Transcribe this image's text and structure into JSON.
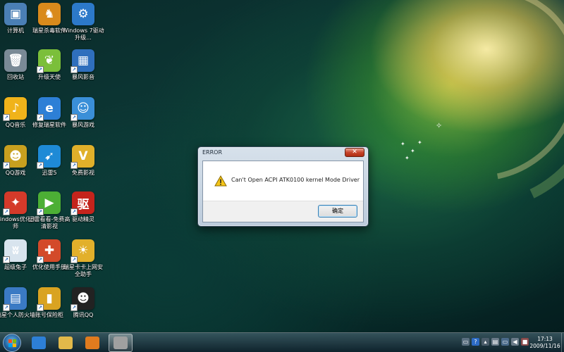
{
  "desktop": {
    "icons": [
      {
        "label": "计算机",
        "glyph": "▣",
        "color": "#4a7fb5"
      },
      {
        "label": "瑞星杀毒软件",
        "glyph": "♞",
        "color": "#d98a1c"
      },
      {
        "label": "Windows 7驱动升级...",
        "glyph": "⚙",
        "color": "#2c79c9"
      },
      {
        "label": "回收站",
        "glyph": "🗑",
        "color": "#7a8a96"
      },
      {
        "label": "升级天使",
        "glyph": "❦",
        "color": "#7bbf3a"
      },
      {
        "label": "暴风影音",
        "glyph": "▦",
        "color": "#2f6fbd"
      },
      {
        "label": "QQ音乐",
        "glyph": "♪",
        "color": "#f0b31a"
      },
      {
        "label": "修复瑞星软件",
        "glyph": "e",
        "color": "#2d7fd6"
      },
      {
        "label": "暴风游戏",
        "glyph": "☺",
        "color": "#3a8fd8"
      },
      {
        "label": "QQ游戏",
        "glyph": "☻",
        "color": "#c8a01f"
      },
      {
        "label": "迅雷5",
        "glyph": "➹",
        "color": "#1e8ad6"
      },
      {
        "label": "免费影视",
        "glyph": "V",
        "color": "#e0b02a"
      },
      {
        "label": "Windows优化大师",
        "glyph": "✦",
        "color": "#d43a2a"
      },
      {
        "label": "迅雷看看-免费高清影视",
        "glyph": "▶",
        "color": "#4caf35"
      },
      {
        "label": "驱动精灵",
        "glyph": "驱",
        "color": "#c4241c"
      },
      {
        "label": "超级兔子",
        "glyph": "ʬ",
        "color": "#d8e4ee"
      },
      {
        "label": "优化使用手册",
        "glyph": "✚",
        "color": "#d34a2a"
      },
      {
        "label": "瑞星卡卡上网安全助手",
        "glyph": "☀",
        "color": "#e2b02b"
      },
      {
        "label": "瑞星个人防火墙",
        "glyph": "▤",
        "color": "#3a7ac4"
      },
      {
        "label": "账号保险柜",
        "glyph": "▮",
        "color": "#d9a321"
      },
      {
        "label": "腾讯QQ",
        "glyph": "☻",
        "color": "#222222"
      }
    ]
  },
  "dialog": {
    "title": "ERROR",
    "close_glyph": "✕",
    "message": "Can't Open ACPI ATK0100 kernel Mode Driver",
    "ok_label": "确定"
  },
  "taskbar": {
    "pinned": [
      {
        "name": "internet-explorer",
        "color": "#2d7fd6"
      },
      {
        "name": "file-explorer",
        "color": "#e2b94a"
      },
      {
        "name": "media-player",
        "color": "#e07b1e"
      },
      {
        "name": "running-app",
        "color": "#a0a0a0"
      }
    ],
    "time": "17:13",
    "date": "2009/11/16"
  }
}
